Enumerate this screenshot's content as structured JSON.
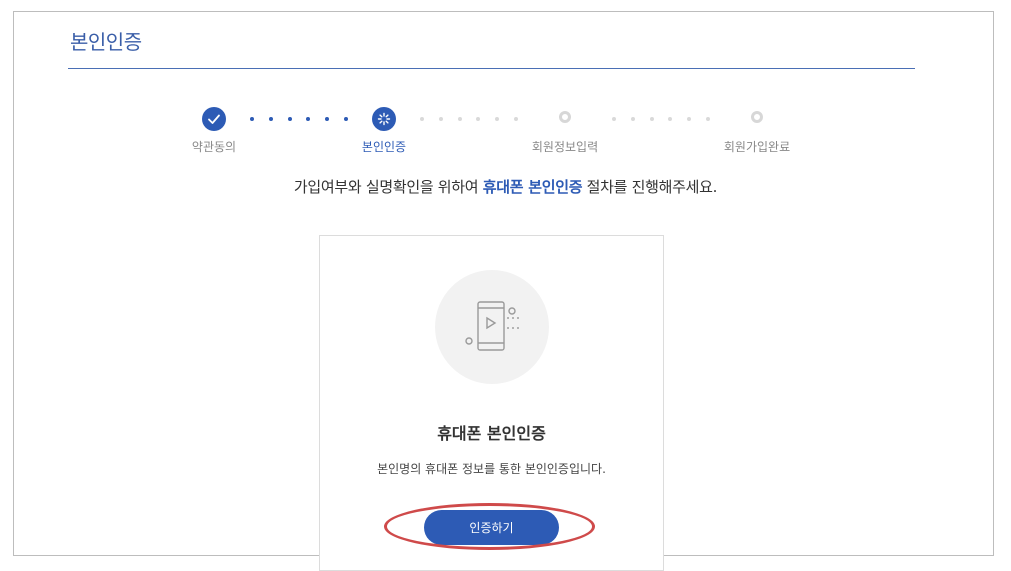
{
  "page": {
    "title": "본인인증"
  },
  "stepper": {
    "steps": [
      {
        "label": "약관동의",
        "state": "done"
      },
      {
        "label": "본인인증",
        "state": "active"
      },
      {
        "label": "회원정보입력",
        "state": "pending"
      },
      {
        "label": "회원가입완료",
        "state": "pending"
      }
    ],
    "accent": "#2d5bb5",
    "inactive": "#d7d7d7"
  },
  "instruction": {
    "before": "가입여부와 실명확인을 위하여 ",
    "highlight": "휴대폰 본인인증",
    "after": " 절차를 진행해주세요."
  },
  "card": {
    "icon": "phone-verification-icon",
    "title": "휴대폰 본인인증",
    "description": "본인명의 휴대폰 정보를 통한 본인인증입니다.",
    "button_label": "인증하기"
  },
  "annotation": {
    "color": "#cf4a4a"
  }
}
